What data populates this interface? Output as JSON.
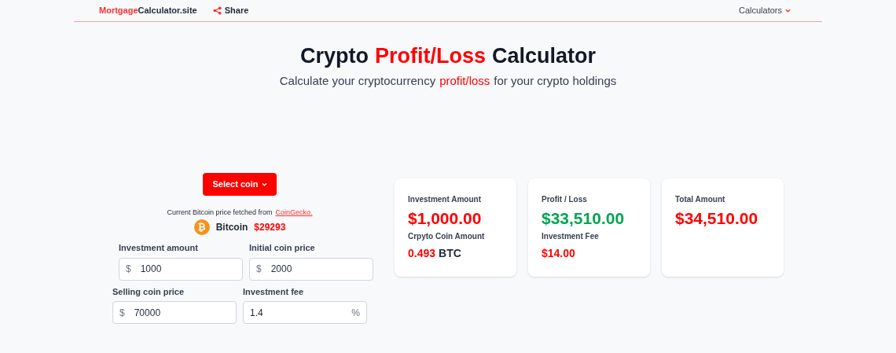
{
  "nav": {
    "brand_highlight": "Mortgage",
    "brand_rest": "Calculator.site",
    "share": "Share",
    "menu": "Calculators"
  },
  "title": [
    {
      "text": "Crypto",
      "highlight": false
    },
    {
      "text": "Profit/Loss",
      "highlight": true
    },
    {
      "text": "Calculator",
      "highlight": false
    }
  ],
  "subtitle": [
    {
      "text": "Calculate your cryptocurrency",
      "highlight": false
    },
    {
      "text": "profit/loss",
      "highlight": true
    },
    {
      "text": "for your crypto holdings",
      "highlight": false
    }
  ],
  "select_button": "Select coin",
  "source": {
    "text": "Current Bitcoin price fetched from",
    "link": "CoinGecko."
  },
  "coin": {
    "symbol": "₿",
    "name": "Bitcoin",
    "price": "$29293"
  },
  "fields": [
    {
      "label": "Investment amount",
      "prefix": "$",
      "value": "1000"
    },
    {
      "label": "Initial coin price",
      "prefix": "$",
      "value": "2000"
    },
    {
      "label": "Selling coin price",
      "prefix": "$",
      "value": "70000"
    },
    {
      "label": "Investment fee",
      "value": "1.4",
      "suffix": "%"
    }
  ],
  "cards": [
    {
      "items": [
        {
          "label": "Investment Amount",
          "value": "$1,000.00",
          "color": "#ff0000",
          "kind": "primary"
        },
        {
          "label": "Crpyto Coin Amount",
          "value": "0.493",
          "unit": "BTC",
          "color": "#ff0000",
          "kind": "secondary"
        }
      ]
    },
    {
      "items": [
        {
          "label": "Profit / Loss",
          "value": "$33,510.00",
          "color": "#00a651",
          "kind": "primary"
        },
        {
          "label": "Investment Fee",
          "value": "$14.00",
          "color": "#ff0000",
          "kind": "secondary"
        }
      ]
    },
    {
      "items": [
        {
          "label": "Total Amount",
          "value": "$34,510.00",
          "color": "#ff0000",
          "kind": "primary"
        }
      ]
    }
  ]
}
